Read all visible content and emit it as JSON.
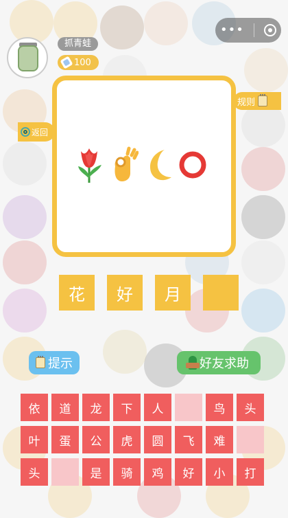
{
  "player": {
    "name": "抓青蛙",
    "coins": "100"
  },
  "tabs": {
    "rules_label": "规则",
    "back_label": "返回"
  },
  "puzzle": {
    "emojis": [
      "tulip-emoji",
      "ok-hand-emoji",
      "crescent-moon-emoji",
      "red-circle-emoji"
    ],
    "answer_slots": [
      "花",
      "好",
      "月",
      ""
    ]
  },
  "buttons": {
    "hint_label": "提示",
    "friend_help_label": "好友求助"
  },
  "candidates": [
    [
      "依",
      "道",
      "龙",
      "下",
      "人",
      "",
      "鸟",
      "头"
    ],
    [
      "叶",
      "蛋",
      "公",
      "虎",
      "圆",
      "飞",
      "难",
      ""
    ],
    [
      "头",
      "",
      "是",
      "骑",
      "鸡",
      "好",
      "小",
      "打"
    ]
  ],
  "colors": {
    "accent_yellow": "#f5c242",
    "chip_red": "#f05e5e",
    "chip_empty": "#f8c6c9",
    "hint_blue": "#6bc0ef",
    "friend_green": "#66c36c"
  }
}
